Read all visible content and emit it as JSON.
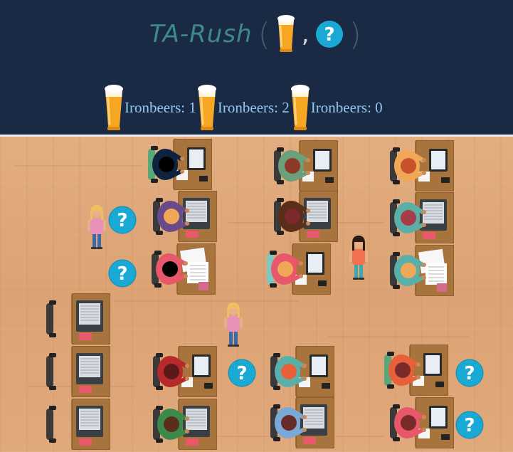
{
  "game": {
    "title": "TA-Rush",
    "title_paren_open": "(",
    "title_comma": ",",
    "title_paren_close": ")",
    "title_icons": [
      "beer-icon",
      "question-mark-icon"
    ]
  },
  "scoreboard": [
    {
      "label": "Ironbeers: 1",
      "icon": "beer-icon"
    },
    {
      "label": "Ironbeers: 2",
      "icon": "beer-icon"
    },
    {
      "label": "Ironbeers: 0",
      "icon": "beer-icon"
    }
  ],
  "colors": {
    "header_bg": "#1b2a44",
    "title_text": "#3e8a86",
    "label_text": "#8fc8f0",
    "floor": "#dca274",
    "desk": "#a8743d",
    "question_bubble": "#1aa9d4"
  },
  "classroom": {
    "desks": [
      {
        "id": "r1c1",
        "shirt": "#0f2240",
        "hair": "#000000",
        "chair": "#5aa87a",
        "device": "tablet"
      },
      {
        "id": "r1c2",
        "shirt": "#6aa07a",
        "hair": "#8b3a2a",
        "chair": "#3a3a3a",
        "device": "tablet"
      },
      {
        "id": "r1c3",
        "shirt": "#f0a858",
        "hair": "#c8522a",
        "chair": "#3a3a3a",
        "device": "tablet"
      },
      {
        "id": "r2c1",
        "shirt": "#6b4a8a",
        "hair": "#f0a858",
        "chair": "#3a3a3a",
        "device": "laptop"
      },
      {
        "id": "r2c2",
        "shirt": "#5a2e1a",
        "hair": "#7a2a2a",
        "chair": "#3a3a3a",
        "device": "laptop"
      },
      {
        "id": "r2c3",
        "shirt": "#5ab0a8",
        "hair": "#a83a4a",
        "chair": "#3a3a3a",
        "device": "laptop"
      },
      {
        "id": "r3c1",
        "shirt": "#e8576a",
        "hair": "#000000",
        "chair": "#3a3a3a",
        "device": "papers"
      },
      {
        "id": "r3c2",
        "shirt": "#e8576a",
        "hair": "#f0a858",
        "chair": "#7ec8c0",
        "device": "tablet"
      },
      {
        "id": "r3c3",
        "shirt": "#5ab0a8",
        "hair": "#f0a858",
        "chair": "#3a3a3a",
        "device": "papers"
      },
      {
        "id": "r4c0",
        "shirt": "",
        "hair": "",
        "chair": "#3a3a3a",
        "device": "laptop"
      },
      {
        "id": "r5c0",
        "shirt": "",
        "hair": "",
        "chair": "#3a3a3a",
        "device": "laptop"
      },
      {
        "id": "r5c1",
        "shirt": "#b82a2a",
        "hair": "#5a1a1a",
        "chair": "#3a3a3a",
        "device": "tablet"
      },
      {
        "id": "r5c2",
        "shirt": "#5ab0a8",
        "hair": "#e8603a",
        "chair": "#3a3a3a",
        "device": "tablet"
      },
      {
        "id": "r5c3",
        "shirt": "#e8603a",
        "hair": "#7a2a2a",
        "chair": "#5aa87a",
        "device": "tablet"
      },
      {
        "id": "r6c0",
        "shirt": "",
        "hair": "",
        "chair": "#3a3a3a",
        "device": "laptop"
      },
      {
        "id": "r6c1",
        "shirt": "#3a8a4a",
        "hair": "#5a2e1a",
        "chair": "#3a3a3a",
        "device": "laptop"
      },
      {
        "id": "r6c2",
        "shirt": "#7aa8d8",
        "hair": "#6a2a2a",
        "chair": "#3a3a3a",
        "device": "laptop"
      },
      {
        "id": "r6c3",
        "shirt": "#e8576a",
        "hair": "#7a2a2a",
        "chair": "#3a3a3a",
        "device": "tablet"
      }
    ],
    "questions": [
      {
        "id": "q-ta1"
      },
      {
        "id": "q-left"
      },
      {
        "id": "q-row5-mid"
      },
      {
        "id": "q-row5-right"
      },
      {
        "id": "q-row6-right"
      }
    ],
    "tas": [
      {
        "id": "ta-blonde-left",
        "hair": "#f0c060",
        "shirt": "#e890b8",
        "pants": "#3a6aa8"
      },
      {
        "id": "ta-curly",
        "hair": "#2a1a10",
        "shirt": "#f07050",
        "pants": "#3aa8b0"
      },
      {
        "id": "ta-blonde-center",
        "hair": "#f0c060",
        "shirt": "#e890b8",
        "pants": "#3a6aa8"
      }
    ]
  }
}
